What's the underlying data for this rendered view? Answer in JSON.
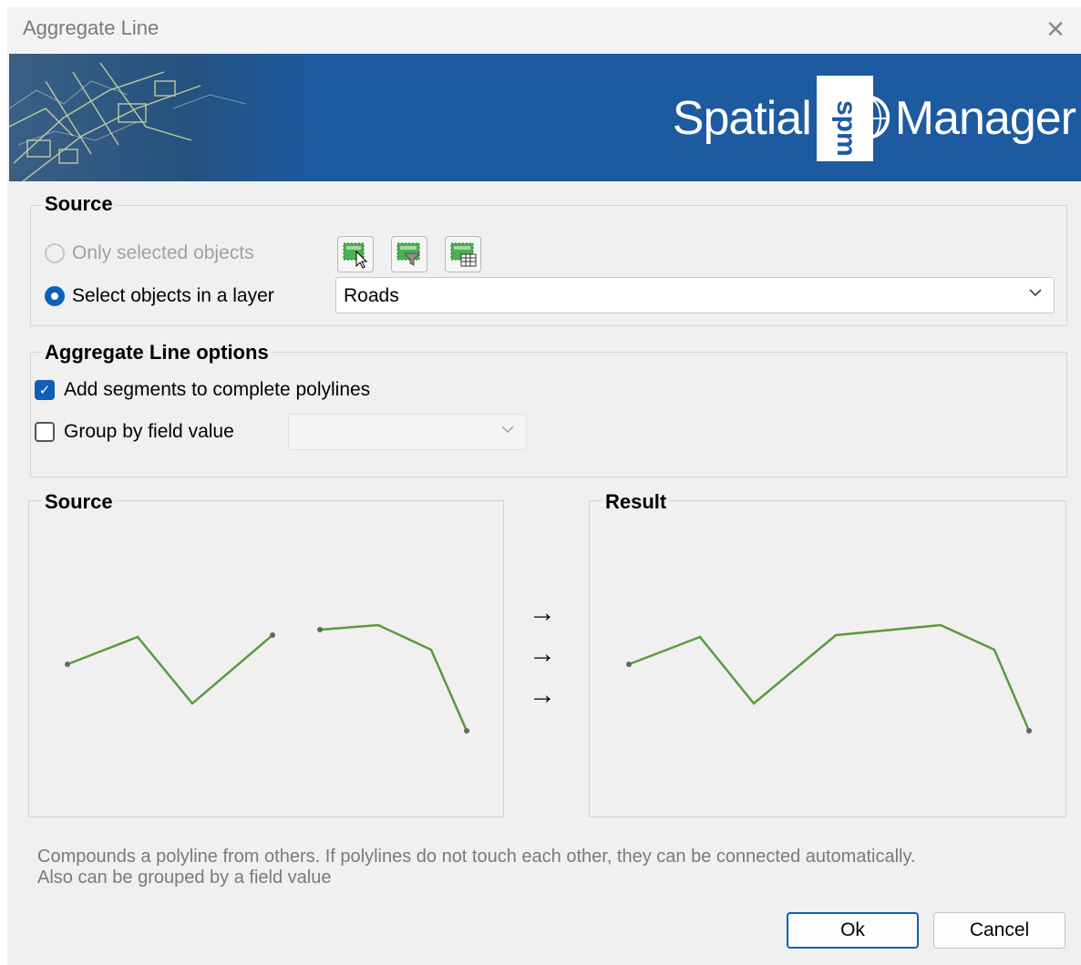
{
  "window": {
    "title": "Aggregate Line",
    "close_icon": "close-icon"
  },
  "banner": {
    "brand_left": "Spatial",
    "brand_logo": "spm",
    "brand_right": "Manager",
    "color": "#1e5aa0"
  },
  "source": {
    "legend": "Source",
    "option_selected": "Only selected objects",
    "option_layer": "Select objects in a layer",
    "selected_option": "Select objects in a layer",
    "tool_icons": [
      "select-objects-icon",
      "filter-objects-icon",
      "table-select-icon"
    ],
    "layer_value": "Roads"
  },
  "options": {
    "legend": "Aggregate Line options",
    "add_segments_label": "Add segments to complete polylines",
    "add_segments_checked": true,
    "group_by_label": "Group by field value",
    "group_by_checked": false,
    "group_by_value": ""
  },
  "preview": {
    "source_legend": "Source",
    "result_legend": "Result",
    "arrows": [
      "→",
      "→",
      "→"
    ],
    "line_color": "#5a9a3c"
  },
  "description": "Compounds a polyline from others. If polylines do not touch each other, they can be connected automatically.\nAlso can be grouped by a field value",
  "buttons": {
    "ok": "Ok",
    "cancel": "Cancel"
  },
  "accent_color": "#0f5fb8"
}
